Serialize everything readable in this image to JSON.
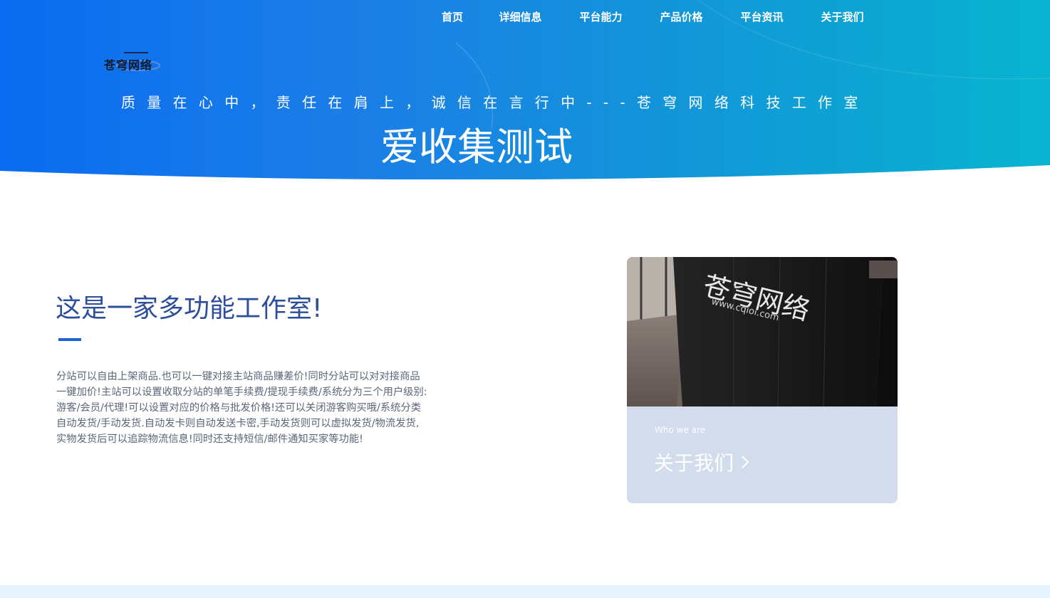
{
  "nav": {
    "items": [
      {
        "label": "首页"
      },
      {
        "label": "详细信息"
      },
      {
        "label": "平台能力"
      },
      {
        "label": "产品价格"
      },
      {
        "label": "平台资讯"
      },
      {
        "label": "关于我们"
      }
    ]
  },
  "logo": {
    "text": "苍穹网络"
  },
  "hero": {
    "slogan": "质量在心中，责任在肩上，诚信在言行中---苍穹网络科技工作室",
    "title": "爱收集测试"
  },
  "intro": {
    "heading": "这是一家多功能工作室!",
    "body_lines": [
      "分站可以自由上架商品.也可以一键对接主站商品赚差价!同时分站可以对对接商品",
      "一键加价!主站可以设置收取分站的单笔手续费/提现手续费/系统分为三个用户级别:",
      "游客/会员/代理!可以设置对应的价格与批发价格!还可以关闭游客购买哦/系统分类",
      "自动发货/手动发货.自动发卡则自动发送卡密,手动发货则可以虚拟发货/物流发货,",
      "实物发货后可以追踪物流信息!同时还支持短信/邮件通知买家等功能!"
    ]
  },
  "card": {
    "photo_sign_text": "苍穹网络",
    "photo_sign_url": "www.cqioi.com",
    "subtitle": "Who we are",
    "link_label": "关于我们"
  },
  "colors": {
    "hero_start": "#0a6cf0",
    "hero_end": "#08b4cf",
    "heading": "#2d4f9b",
    "accent_bar": "#1e62d4",
    "card_bg": "#d2dcec"
  }
}
